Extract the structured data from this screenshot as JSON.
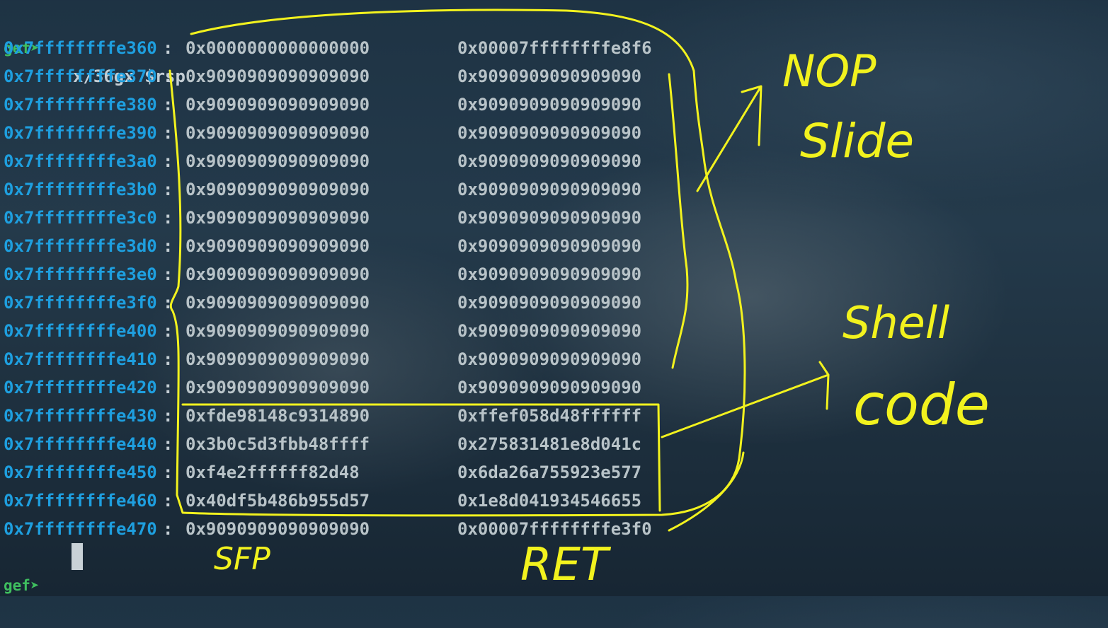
{
  "terminal": {
    "prompt": "gef➤",
    "command": "x/36gx $rsp",
    "rows": [
      {
        "addr": "0x7ffffffffe360",
        "v1": "0x0000000000000000",
        "v2": "0x00007ffffffffe8f6"
      },
      {
        "addr": "0x7ffffffffe370",
        "v1": "0x9090909090909090",
        "v2": "0x9090909090909090"
      },
      {
        "addr": "0x7ffffffffe380",
        "v1": "0x9090909090909090",
        "v2": "0x9090909090909090"
      },
      {
        "addr": "0x7ffffffffe390",
        "v1": "0x9090909090909090",
        "v2": "0x9090909090909090"
      },
      {
        "addr": "0x7ffffffffe3a0",
        "v1": "0x9090909090909090",
        "v2": "0x9090909090909090"
      },
      {
        "addr": "0x7ffffffffe3b0",
        "v1": "0x9090909090909090",
        "v2": "0x9090909090909090"
      },
      {
        "addr": "0x7ffffffffe3c0",
        "v1": "0x9090909090909090",
        "v2": "0x9090909090909090"
      },
      {
        "addr": "0x7ffffffffe3d0",
        "v1": "0x9090909090909090",
        "v2": "0x9090909090909090"
      },
      {
        "addr": "0x7ffffffffe3e0",
        "v1": "0x9090909090909090",
        "v2": "0x9090909090909090"
      },
      {
        "addr": "0x7ffffffffe3f0",
        "v1": "0x9090909090909090",
        "v2": "0x9090909090909090"
      },
      {
        "addr": "0x7ffffffffe400",
        "v1": "0x9090909090909090",
        "v2": "0x9090909090909090"
      },
      {
        "addr": "0x7ffffffffe410",
        "v1": "0x9090909090909090",
        "v2": "0x9090909090909090"
      },
      {
        "addr": "0x7ffffffffe420",
        "v1": "0x9090909090909090",
        "v2": "0x9090909090909090"
      },
      {
        "addr": "0x7ffffffffe430",
        "v1": "0xfde98148c9314890",
        "v2": "0xffef058d48ffffff"
      },
      {
        "addr": "0x7ffffffffe440",
        "v1": "0x3b0c5d3fbb48ffff",
        "v2": "0x275831481e8d041c"
      },
      {
        "addr": "0x7ffffffffe450",
        "v1": "0xf4e2ffffff82d48",
        "v2": "0x6da26a755923e577"
      },
      {
        "addr": "0x7ffffffffe460",
        "v1": "0x40df5b486b955d57",
        "v2": "0x1e8d041934546655"
      },
      {
        "addr": "0x7ffffffffe470",
        "v1": "0x9090909090909090",
        "v2": "0x00007ffffffffe3f0"
      }
    ]
  },
  "annotations": {
    "nop_slide_line1": "NOP",
    "nop_slide_line2": "Slide",
    "shellcode_line1": "Shell",
    "shellcode_line2": "code",
    "sfp_label": "SFP",
    "ret_label": "RET",
    "ink_color": "#f2f21e"
  },
  "colors": {
    "prompt": "#3fbf5f",
    "address": "#1e9fdf",
    "value": "#b8c3c8"
  }
}
